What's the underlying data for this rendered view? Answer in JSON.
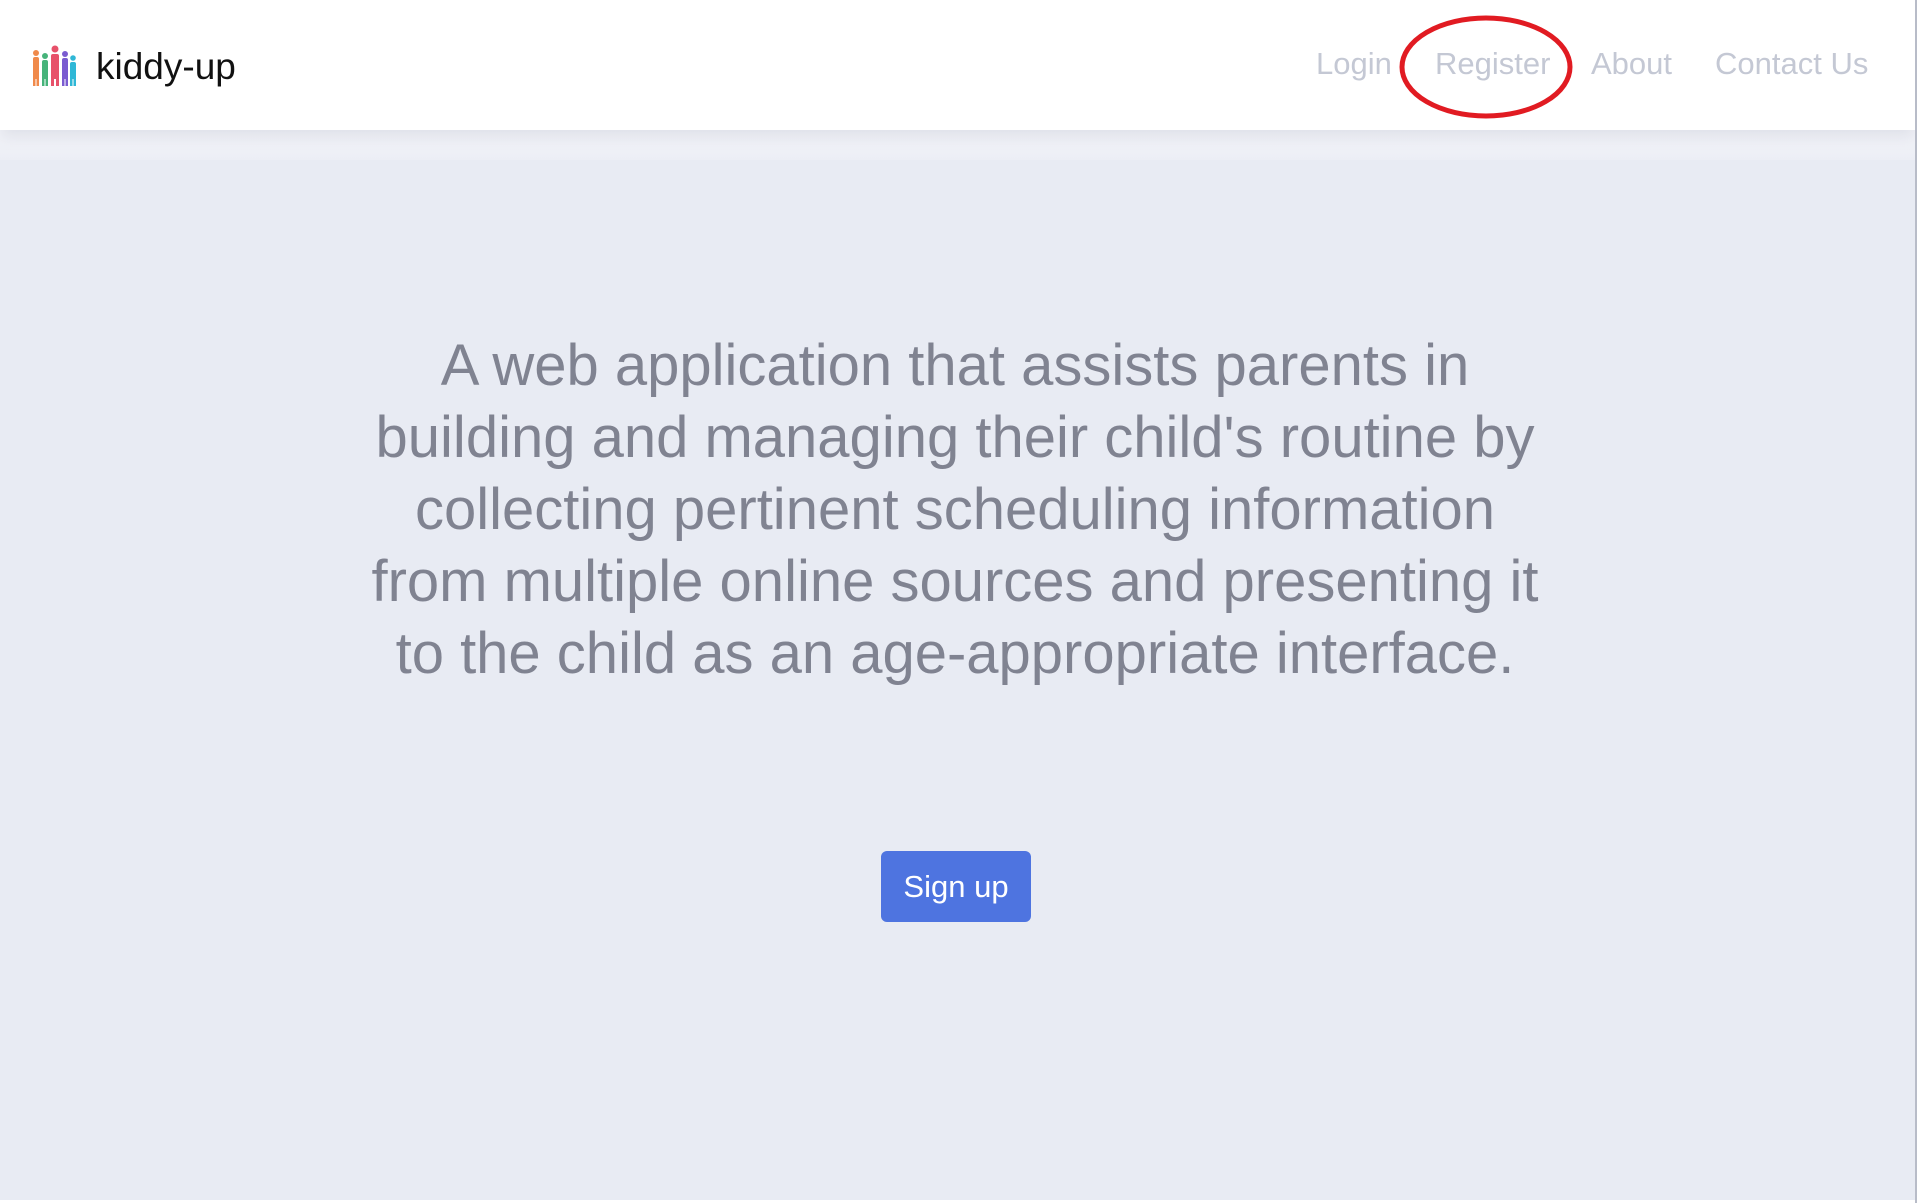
{
  "header": {
    "brand_name": "kiddy-up",
    "brand_logo_icon": "family-people-logo-icon",
    "nav": [
      {
        "label": "Login"
      },
      {
        "label": "Register",
        "highlighted": true,
        "highlight_color": "#e11b22"
      },
      {
        "label": "About"
      },
      {
        "label": "Contact Us"
      }
    ]
  },
  "hero": {
    "tagline": "A web application that assists parents in building and managing their child's routine by collecting pertinent scheduling information from multiple online sources and presenting it to the child as an age-appropriate interface.",
    "signup_label": "Sign up"
  },
  "colors": {
    "nav_link": "#c4c8d4",
    "hero_background": "#e8ebf3",
    "hero_text": "#808391",
    "button_background": "#4e74e0",
    "button_text": "#ffffff",
    "annotation_ring": "#e11b22"
  }
}
